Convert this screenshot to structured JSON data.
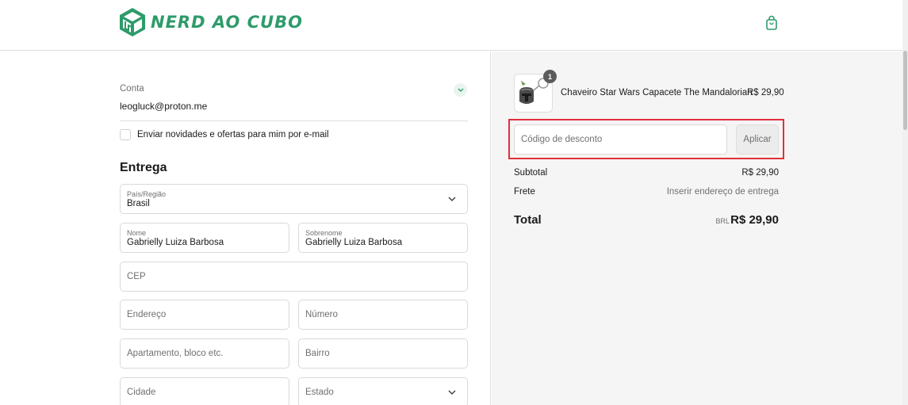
{
  "brand": {
    "name": "NERD AO CUBO",
    "color": "#2e9b6a"
  },
  "header": {
    "cart_icon": "shopping-bag-icon"
  },
  "account": {
    "label": "Conta",
    "email": "leogluck@proton.me"
  },
  "newsletter": {
    "label": "Enviar novidades e ofertas para mim por e-mail",
    "checked": false
  },
  "delivery": {
    "title": "Entrega",
    "country": {
      "label": "País/Região",
      "value": "Brasil"
    },
    "first_name": {
      "label": "Nome",
      "value": "Gabrielly Luiza Barbosa"
    },
    "last_name": {
      "label": "Sobrenome",
      "value": "Gabrielly Luiza Barbosa"
    },
    "cep": {
      "placeholder": "CEP"
    },
    "address": {
      "placeholder": "Endereço"
    },
    "number": {
      "placeholder": "Número"
    },
    "apartment": {
      "placeholder": "Apartamento, bloco etc."
    },
    "district": {
      "placeholder": "Bairro"
    },
    "city": {
      "placeholder": "Cidade"
    },
    "state": {
      "placeholder": "Estado"
    }
  },
  "summary": {
    "product": {
      "name": "Chaveiro Star Wars Capacete The Mandalorian",
      "price": "R$ 29,90",
      "quantity": "1"
    },
    "discount": {
      "placeholder": "Código de desconto",
      "button": "Aplicar",
      "highlight_color": "#e0303a"
    },
    "subtotal": {
      "label": "Subtotal",
      "value": "R$ 29,90"
    },
    "shipping": {
      "label": "Frete",
      "value": "Inserir endereço de entrega"
    },
    "total": {
      "label": "Total",
      "currency": "BRL",
      "value": "R$ 29,90"
    }
  }
}
